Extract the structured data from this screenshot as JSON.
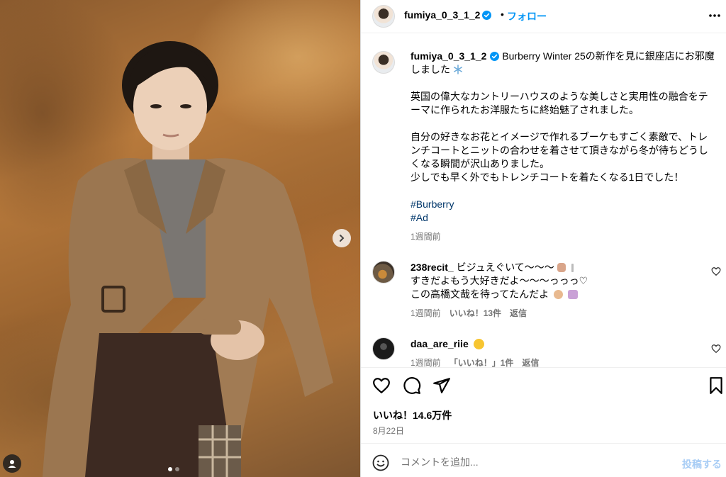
{
  "post": {
    "username": "fumiya_0_3_1_2",
    "separator": "•",
    "follow_label": "フォロー",
    "caption": {
      "first_line": "Burberry Winter 25の新作を見に銀座店にお邪魔しました",
      "para1": "英国の偉大なカントリーハウスのような美しさと実用性の融合をテーマに作られたお洋服たちに終始魅了されました。",
      "para2_line1": "自分の好きなお花とイメージで作れるブーケもすごく素敵で、トレンチコートとニットの合わせを着させて頂きながら冬が待ちどうしくなる瞬間が沢山ありました。",
      "para2_line2": "少しでも早く外でもトレンチコートを着たくなる1日でした！",
      "hashtags": [
        "#Burberry",
        "#Ad"
      ],
      "time": "1週間前"
    },
    "comments": [
      {
        "username": "238recit_",
        "line1": "ビジュえぐいて〜〜〜",
        "line2": "すきだよもう大好きだよ〜〜〜っっっ♡",
        "line3": "この高橋文哉を待ってたんだよ",
        "time": "1週間前",
        "likes": "いいね！13件",
        "reply": "返信"
      },
      {
        "username": "daa_are_riie",
        "line1": "",
        "time": "1週間前",
        "likes": "「いいね！」1件",
        "reply": "返信"
      }
    ],
    "likes_label": "いいね！14.6万件",
    "date": "8月22日",
    "composer": {
      "placeholder": "コメントを追加...",
      "post_label": "投稿する"
    },
    "carousel": {
      "current": 1,
      "total": 2
    }
  },
  "colors": {
    "link_blue": "#0095f6",
    "hashtag": "#00376b",
    "muted": "#737373",
    "post_disabled": "#a8cdf5"
  }
}
